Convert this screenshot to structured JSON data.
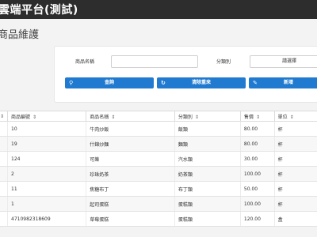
{
  "app": {
    "title": "雲端平台(測試)"
  },
  "page": {
    "title": "商品維護"
  },
  "search": {
    "name_label": "商品名稱",
    "name_value": "",
    "category_label": "分類別",
    "category_value": "請選擇",
    "query_button": "查詢",
    "clear_button": "清除重來",
    "add_button": "新增"
  },
  "table": {
    "columns": [
      "商品編號",
      "商品名稱",
      "分類別",
      "售價",
      "單位"
    ],
    "rows": [
      [
        "10",
        "牛肉炒飯",
        "飯類",
        "80.00",
        "杯"
      ],
      [
        "19",
        "什錦炒麵",
        "麵類",
        "80.00",
        "杯"
      ],
      [
        "124",
        "可樂",
        "汽水類",
        "30.00",
        "杯"
      ],
      [
        "2",
        "珍珠奶茶",
        "奶茶類",
        "100.00",
        "杯"
      ],
      [
        "11",
        "焦糖布丁",
        "布丁類",
        "50.00",
        "杯"
      ],
      [
        "1",
        "起司蛋糕",
        "蛋糕類",
        "100.00",
        "杯"
      ],
      [
        "4710982318609",
        "草莓蛋糕",
        "蛋糕類",
        "120.00",
        "盒"
      ]
    ]
  },
  "colors": {
    "topbar": "#2d2d2d",
    "primary": "#1f7ad0"
  },
  "icons": [
    "search-icon",
    "refresh-icon",
    "pencil-icon",
    "sort-icon"
  ]
}
